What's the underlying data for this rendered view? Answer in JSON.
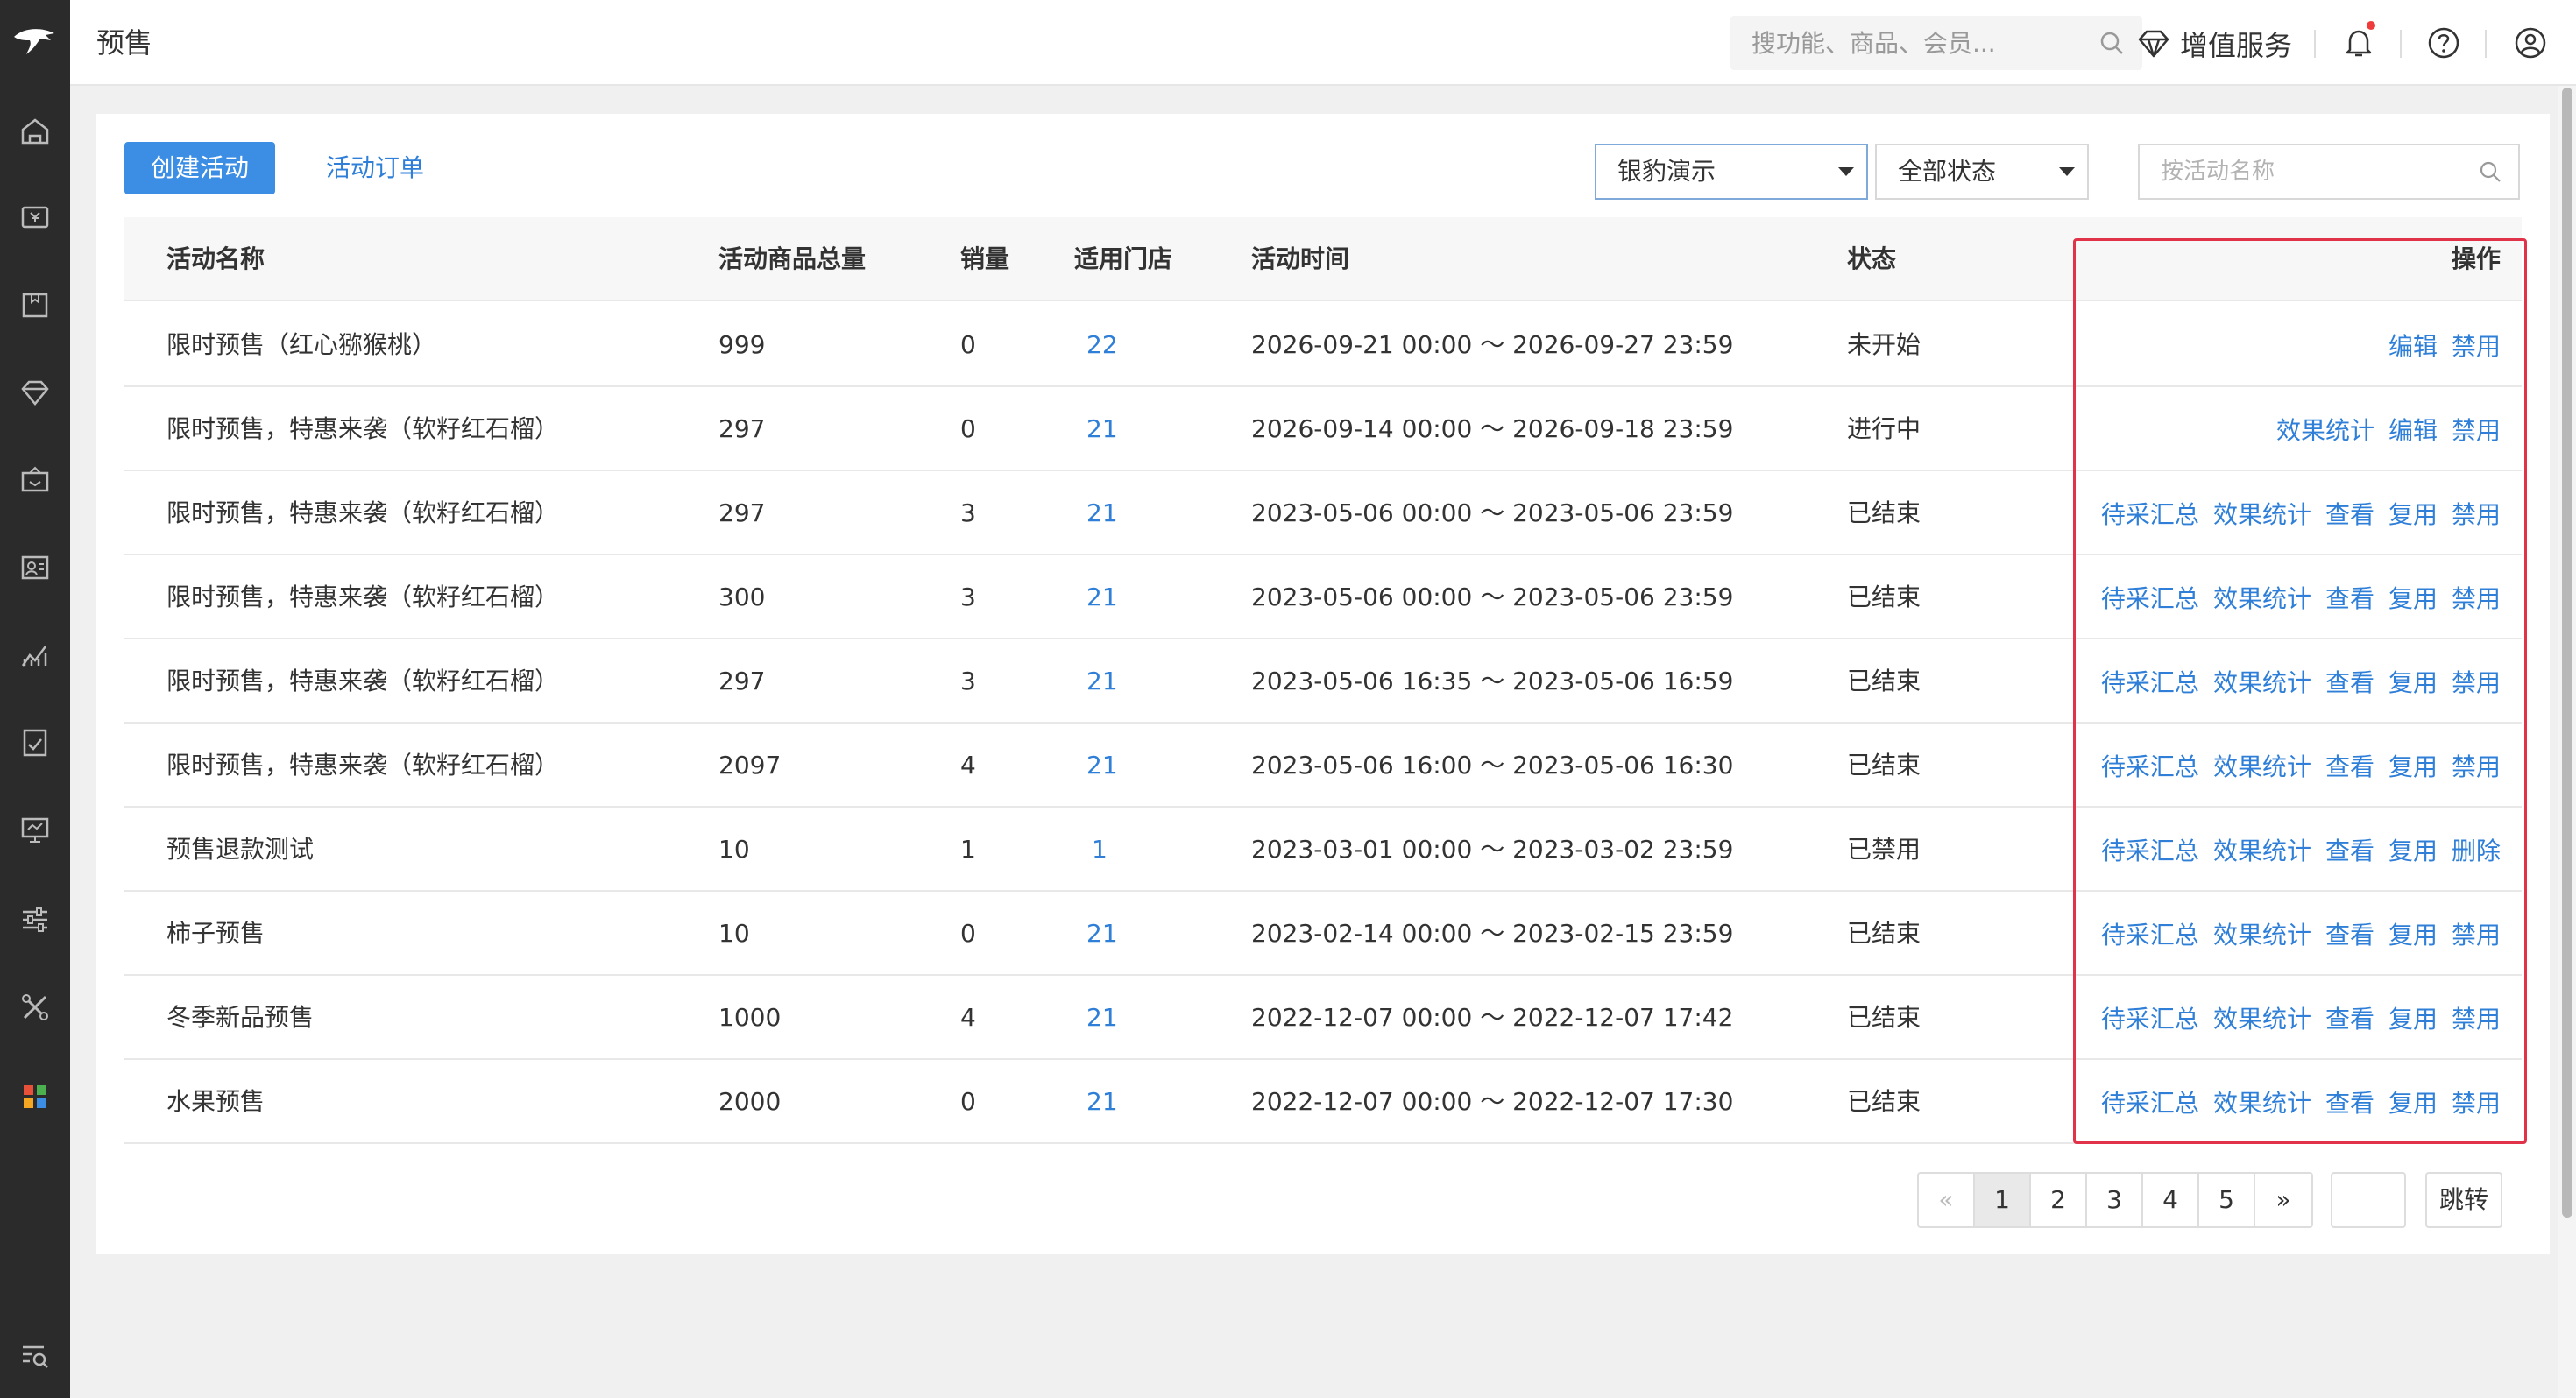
{
  "header": {
    "title": "预售",
    "search_placeholder": "搜功能、商品、会员...",
    "value_added_label": "增值服务",
    "icons": [
      "gem-icon",
      "bell-icon",
      "help-icon",
      "user-icon"
    ]
  },
  "sidebar": {
    "icons": [
      "logo-icon",
      "home-icon",
      "cash-register-icon",
      "product-box-icon",
      "diamond-icon",
      "member-icon",
      "card-icon",
      "chart-icon",
      "report-icon",
      "monitor-icon",
      "sliders-icon",
      "tools-icon",
      "apps-icon",
      "search-list-icon"
    ]
  },
  "toolbar": {
    "create_label": "创建活动",
    "orders_label": "活动订单",
    "store_select": "银豹演示",
    "status_select": "全部状态",
    "name_search_placeholder": "按活动名称"
  },
  "table": {
    "headers": {
      "name": "活动名称",
      "total": "活动商品总量",
      "sales": "销量",
      "stores": "适用门店",
      "time": "活动时间",
      "status": "状态",
      "ops": "操作"
    },
    "rows": [
      {
        "name": "限时预售（红心猕猴桃）",
        "total": "999",
        "sales": "0",
        "stores": "22",
        "time": "2026-09-21 00:00 ～ 2026-09-27 23:59",
        "status": "未开始",
        "ops": [
          "编辑",
          "禁用"
        ]
      },
      {
        "name": "限时预售，特惠来袭（软籽红石榴）",
        "total": "297",
        "sales": "0",
        "stores": "21",
        "time": "2026-09-14 00:00 ～ 2026-09-18 23:59",
        "status": "进行中",
        "ops": [
          "效果统计",
          "编辑",
          "禁用"
        ]
      },
      {
        "name": "限时预售，特惠来袭（软籽红石榴）",
        "total": "297",
        "sales": "3",
        "stores": "21",
        "time": "2023-05-06 00:00 ～ 2023-05-06 23:59",
        "status": "已结束",
        "ops": [
          "待采汇总",
          "效果统计",
          "查看",
          "复用",
          "禁用"
        ]
      },
      {
        "name": "限时预售，特惠来袭（软籽红石榴）",
        "total": "300",
        "sales": "3",
        "stores": "21",
        "time": "2023-05-06 00:00 ～ 2023-05-06 23:59",
        "status": "已结束",
        "ops": [
          "待采汇总",
          "效果统计",
          "查看",
          "复用",
          "禁用"
        ]
      },
      {
        "name": "限时预售，特惠来袭（软籽红石榴）",
        "total": "297",
        "sales": "3",
        "stores": "21",
        "time": "2023-05-06 16:35 ～ 2023-05-06 16:59",
        "status": "已结束",
        "ops": [
          "待采汇总",
          "效果统计",
          "查看",
          "复用",
          "禁用"
        ]
      },
      {
        "name": "限时预售，特惠来袭（软籽红石榴）",
        "total": "2097",
        "sales": "4",
        "stores": "21",
        "time": "2023-05-06 16:00 ～ 2023-05-06 16:30",
        "status": "已结束",
        "ops": [
          "待采汇总",
          "效果统计",
          "查看",
          "复用",
          "禁用"
        ]
      },
      {
        "name": "预售退款测试",
        "total": "10",
        "sales": "1",
        "stores": "1",
        "time": "2023-03-01 00:00 ～ 2023-03-02 23:59",
        "status": "已禁用",
        "ops": [
          "待采汇总",
          "效果统计",
          "查看",
          "复用",
          "删除"
        ]
      },
      {
        "name": "柿子预售",
        "total": "10",
        "sales": "0",
        "stores": "21",
        "time": "2023-02-14 00:00 ～ 2023-02-15 23:59",
        "status": "已结束",
        "ops": [
          "待采汇总",
          "效果统计",
          "查看",
          "复用",
          "禁用"
        ]
      },
      {
        "name": "冬季新品预售",
        "total": "1000",
        "sales": "4",
        "stores": "21",
        "time": "2022-12-07 00:00 ～ 2022-12-07 17:42",
        "status": "已结束",
        "ops": [
          "待采汇总",
          "效果统计",
          "查看",
          "复用",
          "禁用"
        ]
      },
      {
        "name": "水果预售",
        "total": "2000",
        "sales": "0",
        "stores": "21",
        "time": "2022-12-07 00:00 ～ 2022-12-07 17:30",
        "status": "已结束",
        "ops": [
          "待采汇总",
          "效果统计",
          "查看",
          "复用",
          "禁用"
        ]
      }
    ]
  },
  "pagination": {
    "prev": "«",
    "pages": [
      "1",
      "2",
      "3",
      "4",
      "5"
    ],
    "current": "1",
    "next": "»",
    "jump_label": "跳转"
  },
  "colors": {
    "primary": "#3c8ee5",
    "link": "#2f7fd8",
    "sidebar_bg": "#2b2b2b",
    "highlight": "#e0334a"
  }
}
